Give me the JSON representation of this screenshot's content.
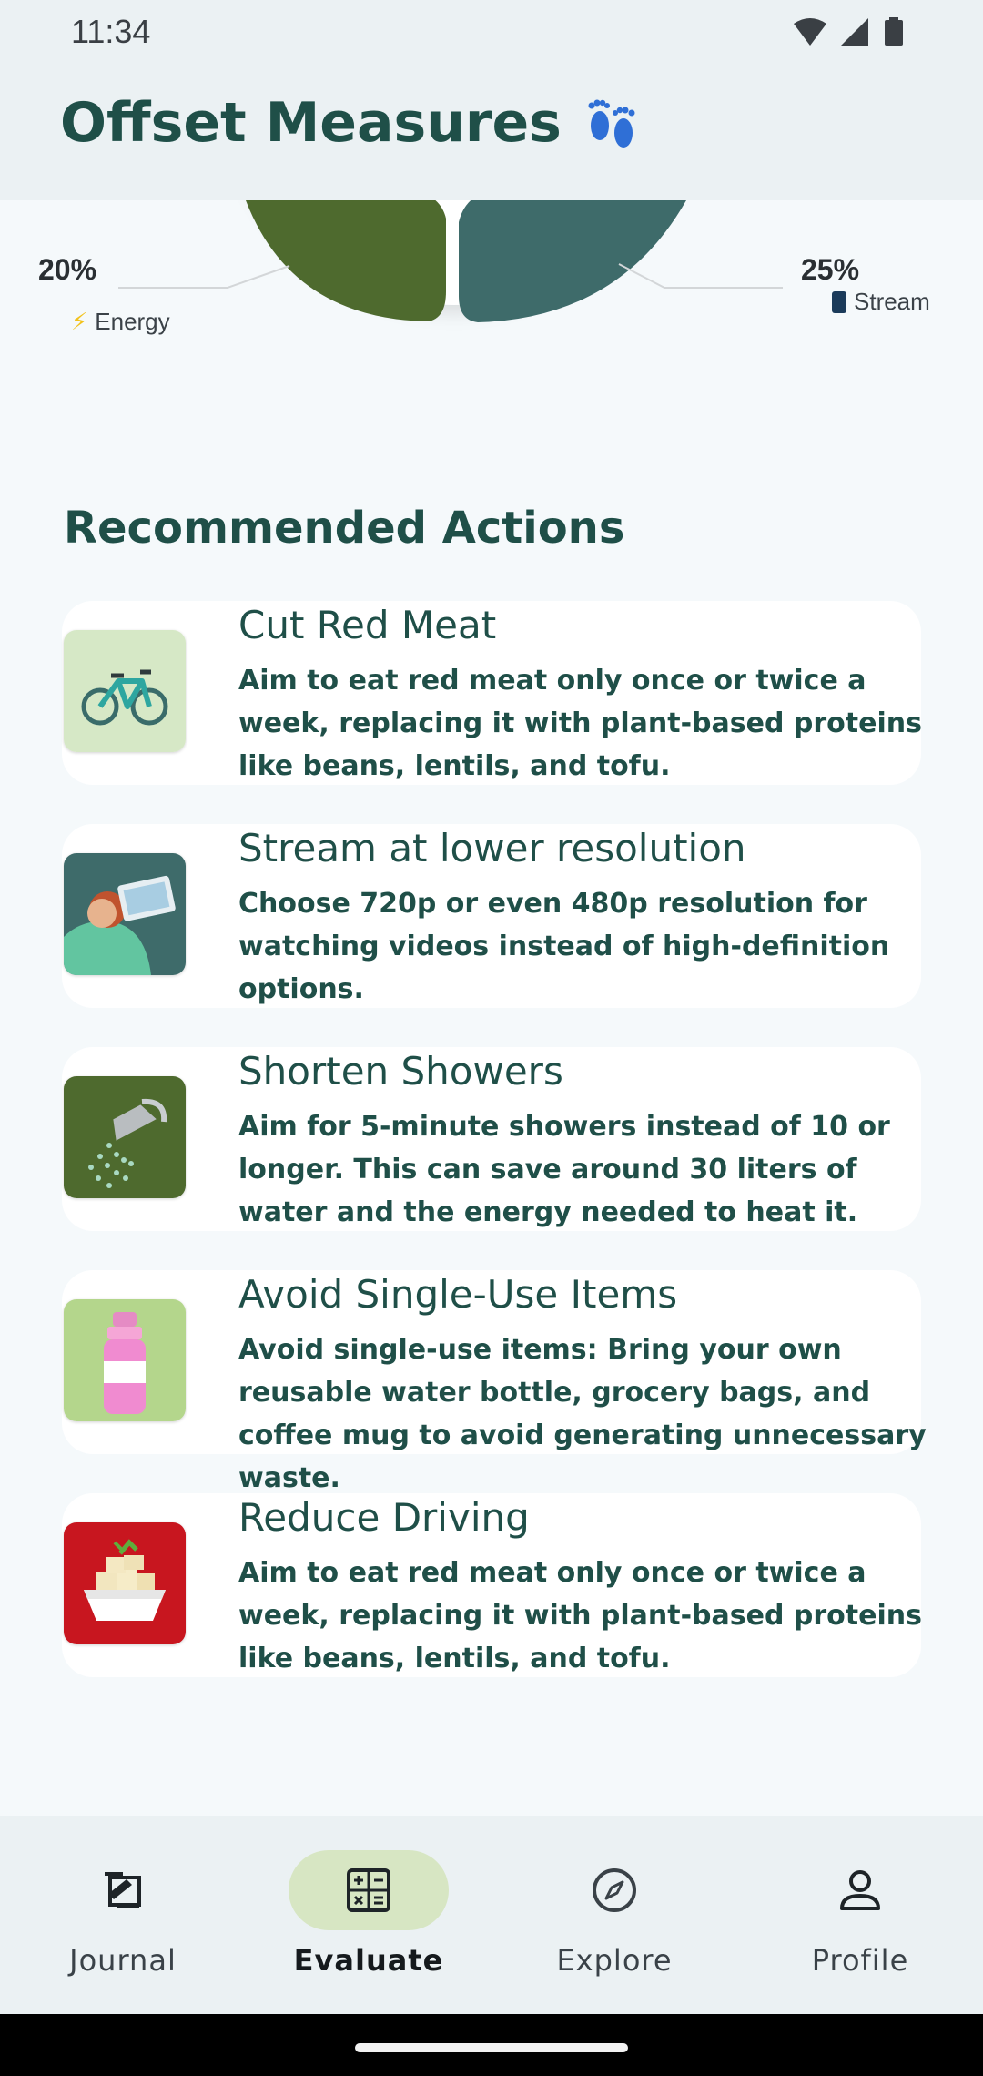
{
  "status_bar": {
    "time": "11:34"
  },
  "app_bar": {
    "title": "Offset Measures",
    "icon": "footprints-icon"
  },
  "chart_fragment": {
    "left_percent": "20%",
    "left_label": "Energy",
    "left_icon": "lightning-icon",
    "right_percent": "25%",
    "right_label": "Stream",
    "right_icon": "phone-icon",
    "colors": {
      "energy": "#4e6a2e",
      "stream": "#3e6b6a"
    }
  },
  "recommended": {
    "title": "Recommended Actions",
    "items": [
      {
        "title": "Cut Red Meat",
        "description": "Aim to eat red meat only once or twice a week, replacing it with plant-based proteins like beans, lentils, and tofu.",
        "icon": "bicycle-icon"
      },
      {
        "title": "Stream at lower resolution",
        "description": "Choose 720p or even 480p resolution for watching videos instead of high-definition options.",
        "icon": "laptop-person-icon"
      },
      {
        "title": "Shorten Showers",
        "description": "Aim for 5-minute showers instead of 10 or longer. This can save around 30 liters of water and the energy needed to heat it.",
        "icon": "shower-icon"
      },
      {
        "title": "Avoid Single-Use Items",
        "description": "Avoid single-use items: Bring your own reusable water bottle, grocery bags, and coffee mug to avoid generating unnecessary waste.",
        "icon": "water-bottle-icon"
      },
      {
        "title": "Reduce Driving",
        "description": "Aim to eat red meat only once or twice a week, replacing it with plant-based proteins like beans, lentils, and tofu.",
        "icon": "tofu-bowl-icon"
      }
    ]
  },
  "bottom_nav": {
    "items": [
      {
        "label": "Journal",
        "icon": "journal-icon",
        "active": false
      },
      {
        "label": "Evaluate",
        "icon": "calculator-icon",
        "active": true
      },
      {
        "label": "Explore",
        "icon": "compass-icon",
        "active": false
      },
      {
        "label": "Profile",
        "icon": "person-icon",
        "active": false
      }
    ],
    "active_pill_color": "#d7e6c3"
  }
}
